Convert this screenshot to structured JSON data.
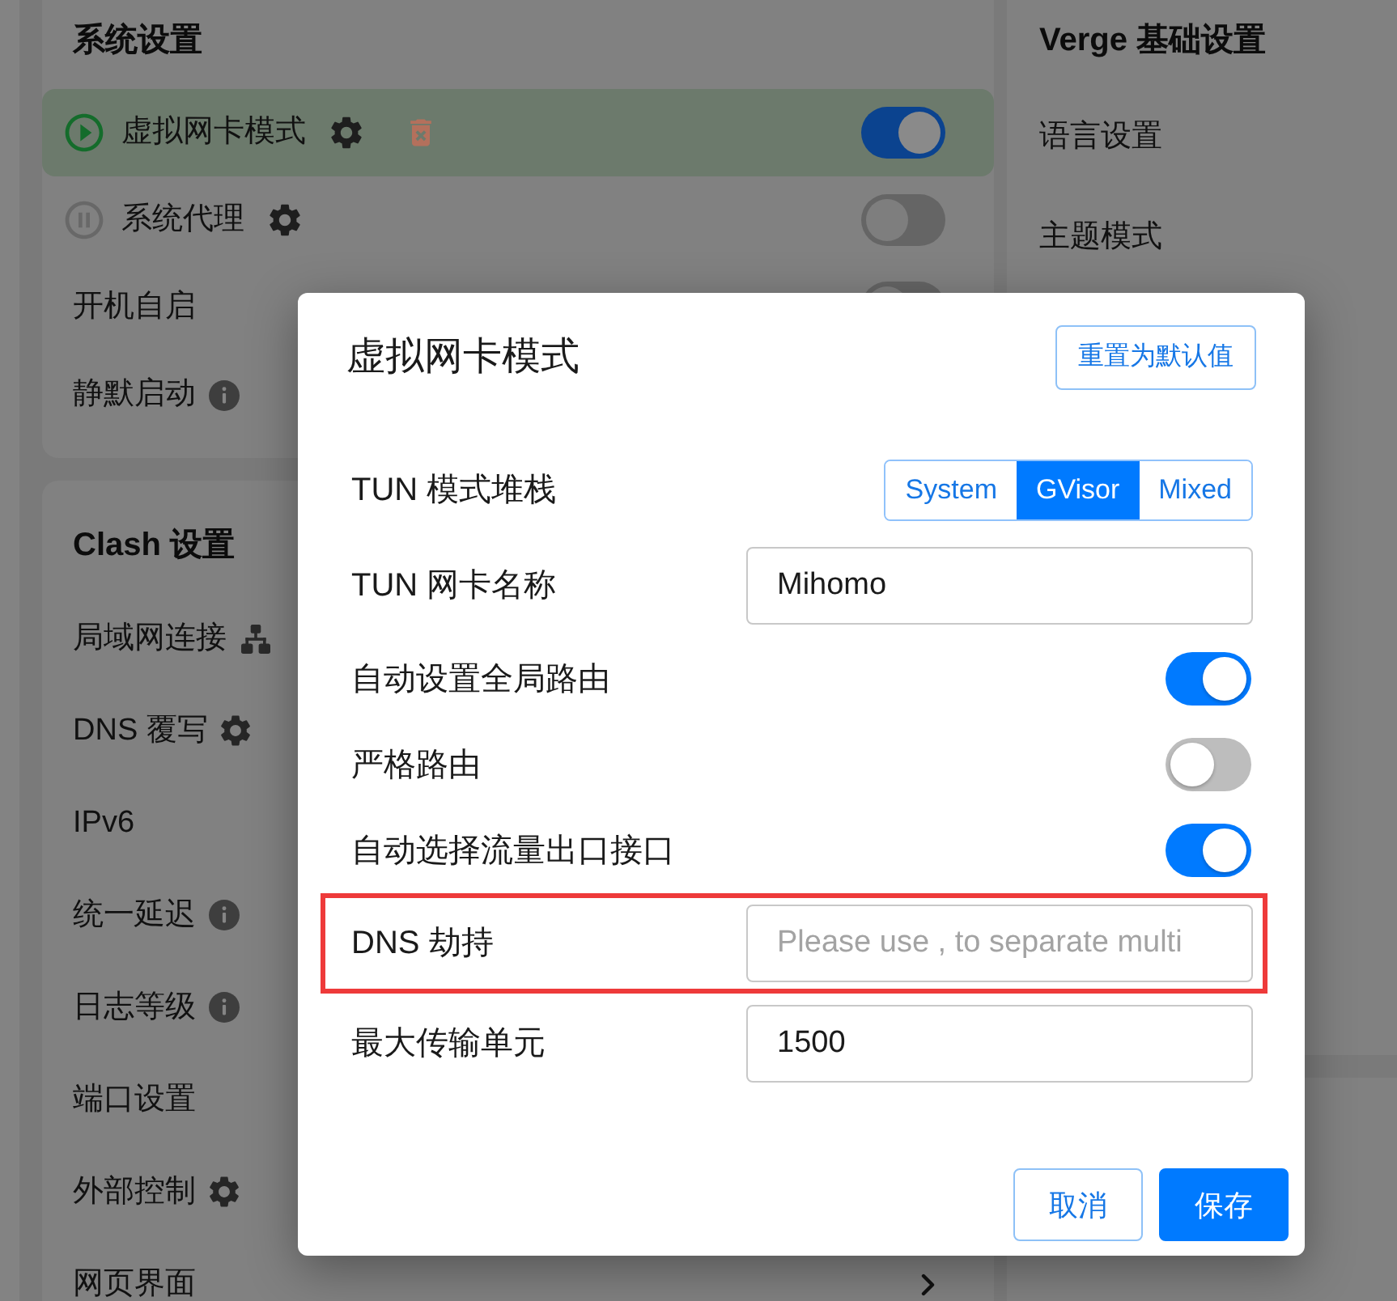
{
  "system_settings": {
    "title": "系统设置",
    "items": [
      {
        "kind": "service",
        "label": "虚拟网卡模式",
        "running": true,
        "highlighted": true,
        "on": true
      },
      {
        "kind": "mode",
        "label": "系统代理",
        "running": false,
        "highlighted": false,
        "on": false
      },
      {
        "kind": "toggle",
        "label": "开机自启",
        "highlighted": false,
        "on": false
      },
      {
        "kind": "info",
        "label": "静默启动",
        "highlighted": false
      }
    ]
  },
  "clash_settings": {
    "title": "Clash 设置",
    "items": [
      {
        "kind": "network",
        "label": "局域网连接"
      },
      {
        "kind": "settings",
        "label": "DNS 覆写"
      },
      {
        "kind": "plain",
        "label": "IPv6"
      },
      {
        "kind": "info",
        "label": "统一延迟"
      },
      {
        "kind": "info",
        "label": "日志等级"
      },
      {
        "kind": "plain",
        "label": "端口设置"
      },
      {
        "kind": "settings",
        "label": "外部控制"
      },
      {
        "kind": "link",
        "label": "网页界面"
      }
    ]
  },
  "verge_settings": {
    "title": "Verge 基础设置",
    "items": [
      {
        "label": "语言设置"
      },
      {
        "label": "主题模式"
      }
    ]
  },
  "dialog": {
    "title": "虚拟网卡模式",
    "reset_button": "重置为默认值",
    "fields": [
      {
        "kind": "segmented",
        "label": "TUN 模式堆栈",
        "highlighted": false,
        "options": [
          {
            "label": "System",
            "selected": false
          },
          {
            "label": "GVisor",
            "selected": true
          },
          {
            "label": "Mixed",
            "selected": false
          }
        ]
      },
      {
        "kind": "input",
        "label": "TUN 网卡名称",
        "highlighted": false,
        "value": "Mihomo"
      },
      {
        "kind": "switch",
        "label": "自动设置全局路由",
        "highlighted": false,
        "on": true
      },
      {
        "kind": "switch",
        "label": "严格路由",
        "highlighted": false,
        "on": false
      },
      {
        "kind": "switch",
        "label": "自动选择流量出口接口",
        "highlighted": false,
        "on": true
      },
      {
        "kind": "input",
        "label": "DNS 劫持",
        "highlighted": true,
        "placeholder": "Please use , to separate multi"
      },
      {
        "kind": "input",
        "label": "最大传输单元",
        "highlighted": false,
        "value": "1500"
      }
    ],
    "buttons": [
      {
        "kind": "outlined",
        "label": "取消"
      },
      {
        "kind": "contained",
        "label": "保存"
      }
    ]
  }
}
